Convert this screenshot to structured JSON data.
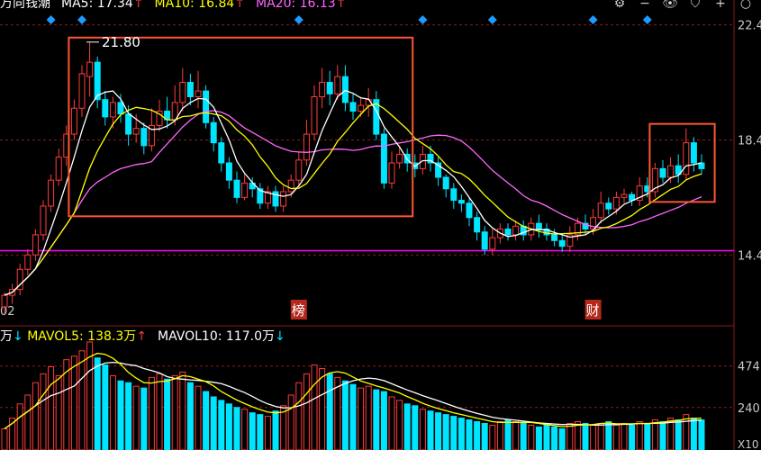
{
  "legend": {
    "stock_name": "万向钱潮",
    "ma5_label": "MA5: 17.34",
    "ma10_label": "MA10: 16.84",
    "ma20_label": "MA20: 16.13",
    "arrow_up": "↑"
  },
  "vol_legend": {
    "prefix": "万",
    "down_arrow": "↓",
    "mavol5_label": "MAVOL5: 138.3万",
    "mavol10_label": "MAVOL10: 117.0万",
    "up_arrow": "↑"
  },
  "toolbar_icons": [
    "settings-icon",
    "minus-icon",
    "eye-icon",
    "shield-icon",
    "plus-icon",
    "close-icon"
  ],
  "toolbar_glyphs": [
    "⚙",
    "−",
    "👁",
    "⛉",
    "+",
    "○"
  ],
  "axis": {
    "price_ticks": [
      "22.4",
      "18.4",
      "14.4"
    ],
    "volume_ticks": [
      "474",
      "240",
      "X10"
    ],
    "date_start_label": "02"
  },
  "markers": {
    "max_price_label": "21.80",
    "bang_label": "榜",
    "cai_label": "财"
  },
  "colors": {
    "up": "#ff3b3b",
    "down": "#00e5ff",
    "ma5": "#ffffff",
    "ma10": "#ffff00",
    "ma20": "#ff66ff",
    "hline": "#ff00ff",
    "box": "#ff5533",
    "grid": "#8b1a1a",
    "diamond": "#1e9bff"
  },
  "chart_data": {
    "type": "candlestick",
    "ylim": [
      12.0,
      22.7
    ],
    "support_line": 14.55,
    "max_annotation": {
      "bar_index": 10,
      "price": 21.8
    },
    "highlight_boxes": [
      [
        9,
        52
      ],
      [
        84,
        91
      ]
    ],
    "candles": [
      [
        12.6,
        13.0,
        12.3,
        13.1
      ],
      [
        13.0,
        13.2,
        12.7,
        13.4
      ],
      [
        13.2,
        13.9,
        13.0,
        14.1
      ],
      [
        13.9,
        14.4,
        13.7,
        14.6
      ],
      [
        14.4,
        15.1,
        14.2,
        15.3
      ],
      [
        15.1,
        16.1,
        14.9,
        16.3
      ],
      [
        16.1,
        17.0,
        15.9,
        17.2
      ],
      [
        17.0,
        17.8,
        16.8,
        18.1
      ],
      [
        17.8,
        18.6,
        17.5,
        18.9
      ],
      [
        18.6,
        19.5,
        18.4,
        19.8
      ],
      [
        19.5,
        20.7,
        19.2,
        21.0
      ],
      [
        20.6,
        21.1,
        19.9,
        21.8
      ],
      [
        21.1,
        19.8,
        19.5,
        21.3
      ],
      [
        19.8,
        19.2,
        18.9,
        20.1
      ],
      [
        19.2,
        19.7,
        18.8,
        19.9
      ],
      [
        19.7,
        19.3,
        19.0,
        20.0
      ],
      [
        19.3,
        18.6,
        18.2,
        19.6
      ],
      [
        18.6,
        18.8,
        18.3,
        19.3
      ],
      [
        18.8,
        18.2,
        17.9,
        19.0
      ],
      [
        18.2,
        18.9,
        18.0,
        19.5
      ],
      [
        18.9,
        19.4,
        18.7,
        19.8
      ],
      [
        19.4,
        19.1,
        18.8,
        19.9
      ],
      [
        19.1,
        19.7,
        18.9,
        20.3
      ],
      [
        19.7,
        20.4,
        19.4,
        20.9
      ],
      [
        20.4,
        19.9,
        19.6,
        20.7
      ],
      [
        19.9,
        20.1,
        19.5,
        20.8
      ],
      [
        20.1,
        19.0,
        18.8,
        20.3
      ],
      [
        19.0,
        18.3,
        18.0,
        19.2
      ],
      [
        18.3,
        17.6,
        17.3,
        18.5
      ],
      [
        17.6,
        17.0,
        16.7,
        17.8
      ],
      [
        17.0,
        16.4,
        16.2,
        17.3
      ],
      [
        16.4,
        16.9,
        16.3,
        17.2
      ],
      [
        16.9,
        16.7,
        16.4,
        17.1
      ],
      [
        16.7,
        16.2,
        16.0,
        16.9
      ],
      [
        16.2,
        16.6,
        16.0,
        16.8
      ],
      [
        16.6,
        16.1,
        15.9,
        16.8
      ],
      [
        16.1,
        16.6,
        15.9,
        16.8
      ],
      [
        16.6,
        17.0,
        16.4,
        17.2
      ],
      [
        17.0,
        17.7,
        16.8,
        18.0
      ],
      [
        17.7,
        18.6,
        17.5,
        19.1
      ],
      [
        18.6,
        19.9,
        18.4,
        20.3
      ],
      [
        19.9,
        20.4,
        19.5,
        20.9
      ],
      [
        20.4,
        20.0,
        19.6,
        20.8
      ],
      [
        20.0,
        20.6,
        19.8,
        21.0
      ],
      [
        20.6,
        19.7,
        19.4,
        21.0
      ],
      [
        19.7,
        19.4,
        19.1,
        20.0
      ],
      [
        19.4,
        19.6,
        19.2,
        19.9
      ],
      [
        19.6,
        19.8,
        19.2,
        20.2
      ],
      [
        19.8,
        18.6,
        18.4,
        20.1
      ],
      [
        18.6,
        16.9,
        16.7,
        18.8
      ],
      [
        16.9,
        17.6,
        16.7,
        18.0
      ],
      [
        17.6,
        17.9,
        17.4,
        18.2
      ],
      [
        17.9,
        17.6,
        17.3,
        18.1
      ],
      [
        17.6,
        17.4,
        17.1,
        17.9
      ],
      [
        17.4,
        17.9,
        17.2,
        18.2
      ],
      [
        17.9,
        17.6,
        17.3,
        18.2
      ],
      [
        17.6,
        17.1,
        16.8,
        17.8
      ],
      [
        17.1,
        16.7,
        16.4,
        17.2
      ],
      [
        16.7,
        16.3,
        16.0,
        16.9
      ],
      [
        16.3,
        16.2,
        15.9,
        16.5
      ],
      [
        16.2,
        15.7,
        15.4,
        16.4
      ],
      [
        15.7,
        15.2,
        14.9,
        15.9
      ],
      [
        15.2,
        14.6,
        14.4,
        15.4
      ],
      [
        14.6,
        15.0,
        14.4,
        15.3
      ],
      [
        15.0,
        15.3,
        14.8,
        15.5
      ],
      [
        15.3,
        15.1,
        14.9,
        15.5
      ],
      [
        15.1,
        15.4,
        14.9,
        15.6
      ],
      [
        15.4,
        15.1,
        14.9,
        15.6
      ],
      [
        15.1,
        15.5,
        14.9,
        15.7
      ],
      [
        15.5,
        15.3,
        15.0,
        15.8
      ],
      [
        15.3,
        15.1,
        14.9,
        15.5
      ],
      [
        15.1,
        14.9,
        14.7,
        15.3
      ],
      [
        14.9,
        14.7,
        14.5,
        15.1
      ],
      [
        14.7,
        15.1,
        14.5,
        15.4
      ],
      [
        15.1,
        15.5,
        14.9,
        15.7
      ],
      [
        15.5,
        15.3,
        15.1,
        15.8
      ],
      [
        15.3,
        15.7,
        15.1,
        16.0
      ],
      [
        15.7,
        16.2,
        15.5,
        16.6
      ],
      [
        16.2,
        16.0,
        15.8,
        16.4
      ],
      [
        16.0,
        16.4,
        15.8,
        16.6
      ],
      [
        16.4,
        16.5,
        16.2,
        16.7
      ],
      [
        16.5,
        16.3,
        16.1,
        16.6
      ],
      [
        16.3,
        16.8,
        16.1,
        17.1
      ],
      [
        16.8,
        16.6,
        16.4,
        17.1
      ],
      [
        16.6,
        17.4,
        16.4,
        17.6
      ],
      [
        17.4,
        17.1,
        16.9,
        17.7
      ],
      [
        17.1,
        17.5,
        16.9,
        17.8
      ],
      [
        17.5,
        17.2,
        16.9,
        17.9
      ],
      [
        17.2,
        18.3,
        17.0,
        18.8
      ],
      [
        18.3,
        17.6,
        17.3,
        18.5
      ],
      [
        17.6,
        17.4,
        17.2,
        17.9
      ]
    ],
    "mavol5": [],
    "mavol10": [],
    "volume_label_units": "万",
    "volumes": [
      120,
      180,
      260,
      310,
      380,
      430,
      470,
      420,
      510,
      530,
      560,
      610,
      520,
      480,
      420,
      390,
      380,
      360,
      350,
      410,
      430,
      400,
      420,
      440,
      380,
      360,
      330,
      300,
      280,
      260,
      240,
      230,
      210,
      200,
      190,
      220,
      250,
      310,
      380,
      430,
      480,
      460,
      430,
      410,
      390,
      370,
      350,
      360,
      340,
      330,
      300,
      280,
      260,
      250,
      230,
      220,
      210,
      200,
      190,
      180,
      170,
      160,
      150,
      140,
      160,
      170,
      160,
      150,
      140,
      130,
      140,
      130,
      120,
      150,
      160,
      150,
      140,
      150,
      160,
      140,
      150,
      140,
      160,
      150,
      170,
      160,
      180,
      170,
      200,
      180,
      170
    ]
  }
}
